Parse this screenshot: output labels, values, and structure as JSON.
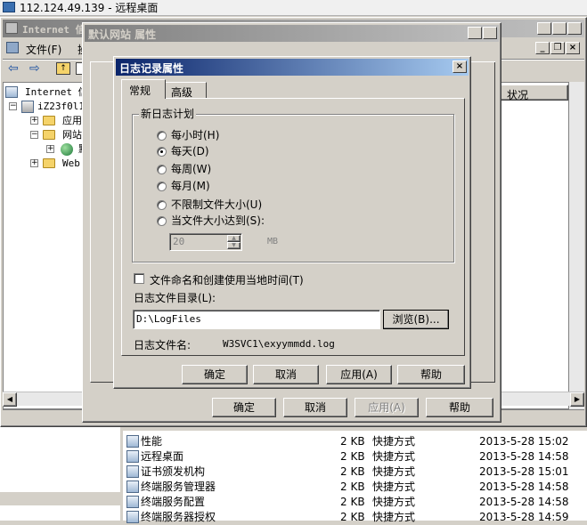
{
  "rdp": {
    "title": "112.124.49.139 - 远程桌面"
  },
  "mmc": {
    "title": "Internet 信",
    "menu": {
      "file": "文件(F)",
      "action": "操"
    },
    "status_col": "状况",
    "tree": [
      {
        "label": "Internet 信"
      },
      {
        "label": "iZ23f0l1"
      },
      {
        "label": "应用"
      },
      {
        "label": "网站"
      },
      {
        "label": "默"
      },
      {
        "label": "Web"
      }
    ]
  },
  "site_props": {
    "title": "默认网站 属性",
    "ok": "确定",
    "cancel": "取消",
    "apply": "应用(A)",
    "help": "帮助"
  },
  "log_dialog": {
    "title": "日志记录属性",
    "tabs": [
      {
        "label": "常规"
      },
      {
        "label": "高级"
      }
    ],
    "group_label": "新日志计划",
    "options": [
      {
        "label": "每小时(H)",
        "checked": false
      },
      {
        "label": "每天(D)",
        "checked": true
      },
      {
        "label": "每周(W)",
        "checked": false
      },
      {
        "label": "每月(M)",
        "checked": false
      },
      {
        "label": "不限制文件大小(U)",
        "checked": false
      },
      {
        "label": "当文件大小达到(S):",
        "checked": false
      }
    ],
    "size_value": "20",
    "size_unit": "MB",
    "localtime_label": "文件命名和创建使用当地时间(T)",
    "dir_label": "日志文件目录(L):",
    "dir_value": "D:\\LogFiles",
    "browse": "浏览(B)...",
    "filename_label": "日志文件名:",
    "filename_value": "W3SVC1\\exyymmdd.log",
    "ok": "确定",
    "cancel": "取消",
    "apply": "应用(A)",
    "help": "帮助"
  },
  "explorer": {
    "rows": [
      {
        "name": "性能",
        "size": "2 KB",
        "type": "快捷方式",
        "date": "2013-5-28 15:02"
      },
      {
        "name": "远程桌面",
        "size": "2 KB",
        "type": "快捷方式",
        "date": "2013-5-28 14:58"
      },
      {
        "name": "证书颁发机构",
        "size": "2 KB",
        "type": "快捷方式",
        "date": "2013-5-28 15:01"
      },
      {
        "name": "终端服务管理器",
        "size": "2 KB",
        "type": "快捷方式",
        "date": "2013-5-28 14:58"
      },
      {
        "name": "终端服务配置",
        "size": "2 KB",
        "type": "快捷方式",
        "date": "2013-5-28 14:58"
      },
      {
        "name": "终端服务器授权",
        "size": "2 KB",
        "type": "快捷方式",
        "date": "2013-5-28 14:59"
      }
    ]
  }
}
